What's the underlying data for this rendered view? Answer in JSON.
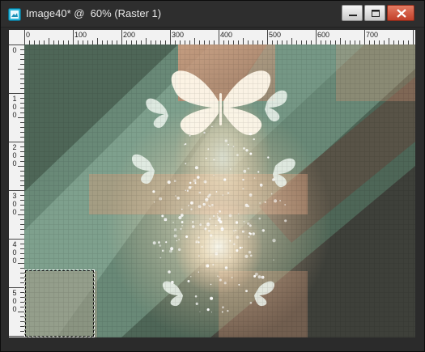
{
  "window": {
    "title": "Image40* @  60% (Raster 1)"
  },
  "controls": {
    "minimize": "minimize-button",
    "maximize": "maximize-button",
    "close": "close-button"
  },
  "ruler": {
    "top_labels": [
      "0",
      "100",
      "200",
      "300",
      "400",
      "500",
      "600",
      "700"
    ],
    "left_labels": [
      [
        "0"
      ],
      [
        "1",
        "0",
        "0"
      ],
      [
        "2",
        "0",
        "0"
      ],
      [
        "3",
        "0",
        "0"
      ],
      [
        "4",
        "0",
        "0"
      ],
      [
        "5",
        "0",
        "0"
      ]
    ]
  },
  "colors": {
    "teal": "#4e6657",
    "mint": "#8fb9a6",
    "peach": "#d89a7a",
    "dark": "#3a3530",
    "glow": "#fff8ea"
  }
}
